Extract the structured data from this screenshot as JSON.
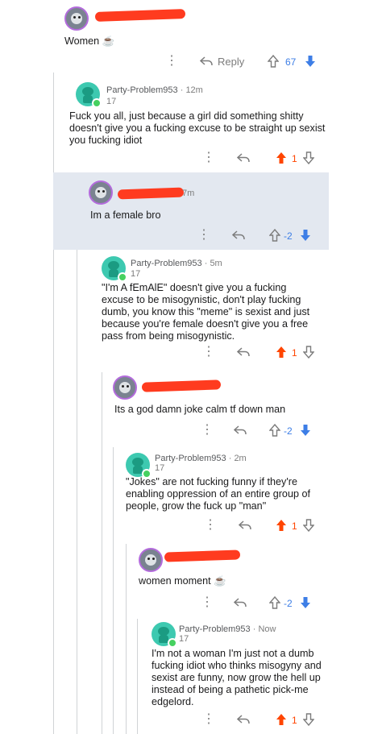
{
  "comments": [
    {
      "author": "",
      "time": "",
      "body": "Women ☕",
      "vote_count": "67",
      "reply_label": "Reply"
    },
    {
      "author": "Party-Problem953",
      "time": "12m",
      "score": "17",
      "body": "Fuck you all, just because a girl did something shitty doesn't give you a fucking excuse to be straight up sexist you fucking idiot",
      "vote_count": "1"
    },
    {
      "author": "",
      "time": "7m",
      "body": "Im a female bro",
      "vote_count": "-2"
    },
    {
      "author": "Party-Problem953",
      "time": "5m",
      "score": "17",
      "body": "\"I'm A fEmAlE\" doesn't give you a fucking excuse to be misogynistic, don't play fucking dumb, you know this \"meme\" is sexist and just because you're female doesn't give you a free pass from being misogynistic.",
      "vote_count": "1"
    },
    {
      "author": "",
      "time": "",
      "body": "Its a god damn joke calm tf down man",
      "vote_count": "-2"
    },
    {
      "author": "Party-Problem953",
      "time": "2m",
      "score": "17",
      "body": "\"Jokes\" are not fucking funny if they're enabling oppression of an entire group of people, grow the fuck up \"man\"",
      "vote_count": "1"
    },
    {
      "author": "",
      "time": "",
      "body": "women moment ☕",
      "vote_count": "-2"
    },
    {
      "author": "Party-Problem953",
      "time": "Now",
      "score": "17",
      "body": "I'm not a woman I'm just not a dumb fucking idiot who thinks misogyny and sexist are funny, now grow the hell up instead of being a pathetic pick-me edgelord.",
      "vote_count": "1"
    }
  ],
  "colors": {
    "upvote_active": "#ff4500",
    "downvote_active": "#3d7ee6",
    "redaction": "#ff3b1f",
    "highlight_bg": "#e3e8f0",
    "thread_line": "#d0d3d6"
  },
  "icons": {
    "more": "more-options-icon",
    "reply": "reply-arrow-icon",
    "upvote": "upvote-arrow-icon",
    "downvote": "downvote-arrow-icon",
    "avatar_custom": "mascot-avatar-icon",
    "avatar_default": "snoo-avatar-icon"
  }
}
